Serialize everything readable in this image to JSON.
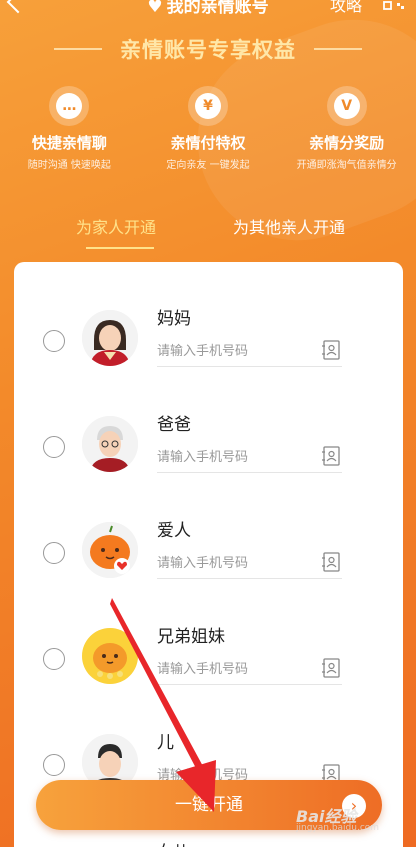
{
  "header": {
    "title": "我的亲情账号",
    "strategy_label": "攻略"
  },
  "banner": {
    "title": "亲情账号专享权益"
  },
  "benefits": [
    {
      "icon": "chat-icon",
      "title": "快捷亲情聊",
      "subtitle": "随时沟通 快速唤起"
    },
    {
      "icon": "pay-icon",
      "title": "亲情付特权",
      "subtitle": "定向亲友 一键发起"
    },
    {
      "icon": "reward-icon",
      "title": "亲情分奖励",
      "subtitle": "开通即涨淘气值亲情分"
    }
  ],
  "tabs": {
    "self_label": "为家人开通",
    "other_label": "为其他亲人开通",
    "active": "self"
  },
  "members": [
    {
      "name": "妈妈",
      "placeholder": "请输入手机号码",
      "avatar": "mother-avatar"
    },
    {
      "name": "爸爸",
      "placeholder": "请输入手机号码",
      "avatar": "father-avatar"
    },
    {
      "name": "爱人",
      "placeholder": "请输入手机号码",
      "avatar": "spouse-avatar"
    },
    {
      "name": "兄弟姐妹",
      "placeholder": "请输入手机号码",
      "avatar": "sibling-avatar"
    },
    {
      "name": "儿",
      "placeholder": "请输入手机号码",
      "avatar": "son-avatar"
    }
  ],
  "next_member_partial": "女儿",
  "cta": {
    "label": "一键开通"
  },
  "watermark": {
    "brand": "Bai经验",
    "url": "jingyan.baidu.com"
  },
  "colors": {
    "accent": "#f38a2a",
    "tab_active": "#ffe28a",
    "banner_title": "#ffe7a8",
    "annotation_arrow": "#e8262a"
  }
}
